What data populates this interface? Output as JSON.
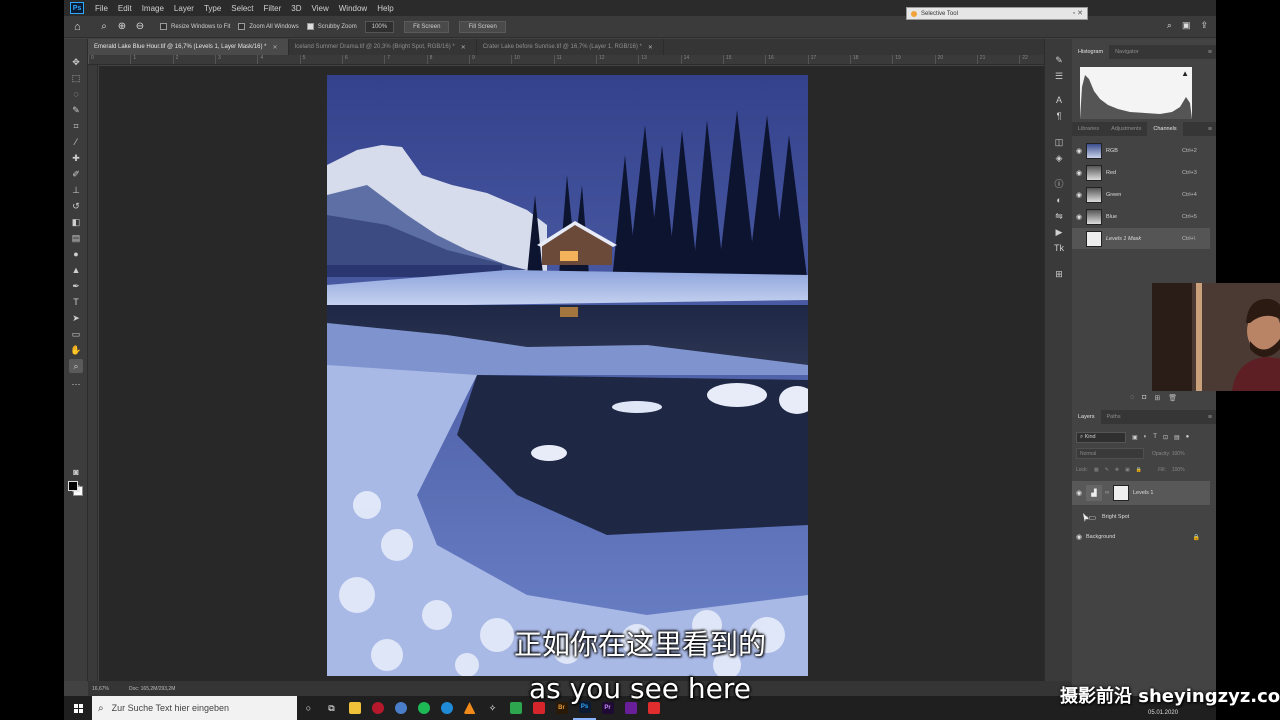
{
  "menu": {
    "app_logo": "Ps",
    "items": [
      "File",
      "Edit",
      "Image",
      "Layer",
      "Type",
      "Select",
      "Filter",
      "3D",
      "View",
      "Window",
      "Help"
    ]
  },
  "selective_tool": {
    "title": "Selective Tool"
  },
  "options_bar": {
    "resize_windows": "Resize Windows to Fit",
    "zoom_all_windows": "Zoom All Windows",
    "scrubby_zoom": "Scrubby Zoom",
    "zoom_value": "100%",
    "fit_screen": "Fit Screen",
    "fill_screen": "Fill Screen"
  },
  "tabs": [
    {
      "label": "Emerald Lake Blue Hour.tif @ 16,7% (Levels 1, Layer Mask/16) *",
      "active": true
    },
    {
      "label": "Iceland Summer Drama.tif @ 20,3% (Bright Spot, RGB/16) *",
      "active": false
    },
    {
      "label": "Crater Lake before Sunrise.tif @ 16,7% (Layer 1, RGB/16) *",
      "active": false
    }
  ],
  "ruler_ticks": [
    "0",
    "1",
    "2",
    "3",
    "4",
    "5",
    "6",
    "7",
    "8",
    "9",
    "10",
    "11",
    "12",
    "13",
    "14",
    "15",
    "16",
    "17",
    "18",
    "19",
    "20",
    "21",
    "22",
    "23"
  ],
  "status": {
    "zoom": "16,67%",
    "doc": "Doc: 165,2M/293,2M"
  },
  "panels": {
    "top_tabs": [
      "Histogram",
      "Navigator"
    ],
    "mid_tabs": [
      "Libraries",
      "Adjustments",
      "Channels"
    ],
    "channels": [
      {
        "name": "RGB",
        "shortcut": "Ctrl+2"
      },
      {
        "name": "Red",
        "shortcut": "Ctrl+3"
      },
      {
        "name": "Green",
        "shortcut": "Ctrl+4"
      },
      {
        "name": "Blue",
        "shortcut": "Ctrl+5"
      },
      {
        "name": "Levels 1 Mask",
        "shortcut": "Ctrl+\\"
      }
    ],
    "layer_tabs": [
      "Layers",
      "Paths"
    ],
    "kind_filter": "Kind",
    "blend_mode": "Normal",
    "opacity_label": "Opacity:",
    "opacity_value": "100%",
    "lock_label": "Lock:",
    "fill_label": "Fill:",
    "fill_value": "100%",
    "layers": [
      {
        "name": "Levels 1",
        "selected": true
      },
      {
        "name": "Bright Spot",
        "selected": false
      },
      {
        "name": "Background",
        "selected": false
      }
    ]
  },
  "subtitles": {
    "chinese": "正如你在这里看到的",
    "english": "as you see here"
  },
  "watermark": "摄影前沿 sheyingzyz.com",
  "taskbar": {
    "search_placeholder": "Zur Suche Text hier eingeben",
    "date": "05.01.2020"
  },
  "colors": {
    "accent_blue": "#31a8ff",
    "panel_bg": "#434343",
    "canvas_bg": "#282828"
  }
}
